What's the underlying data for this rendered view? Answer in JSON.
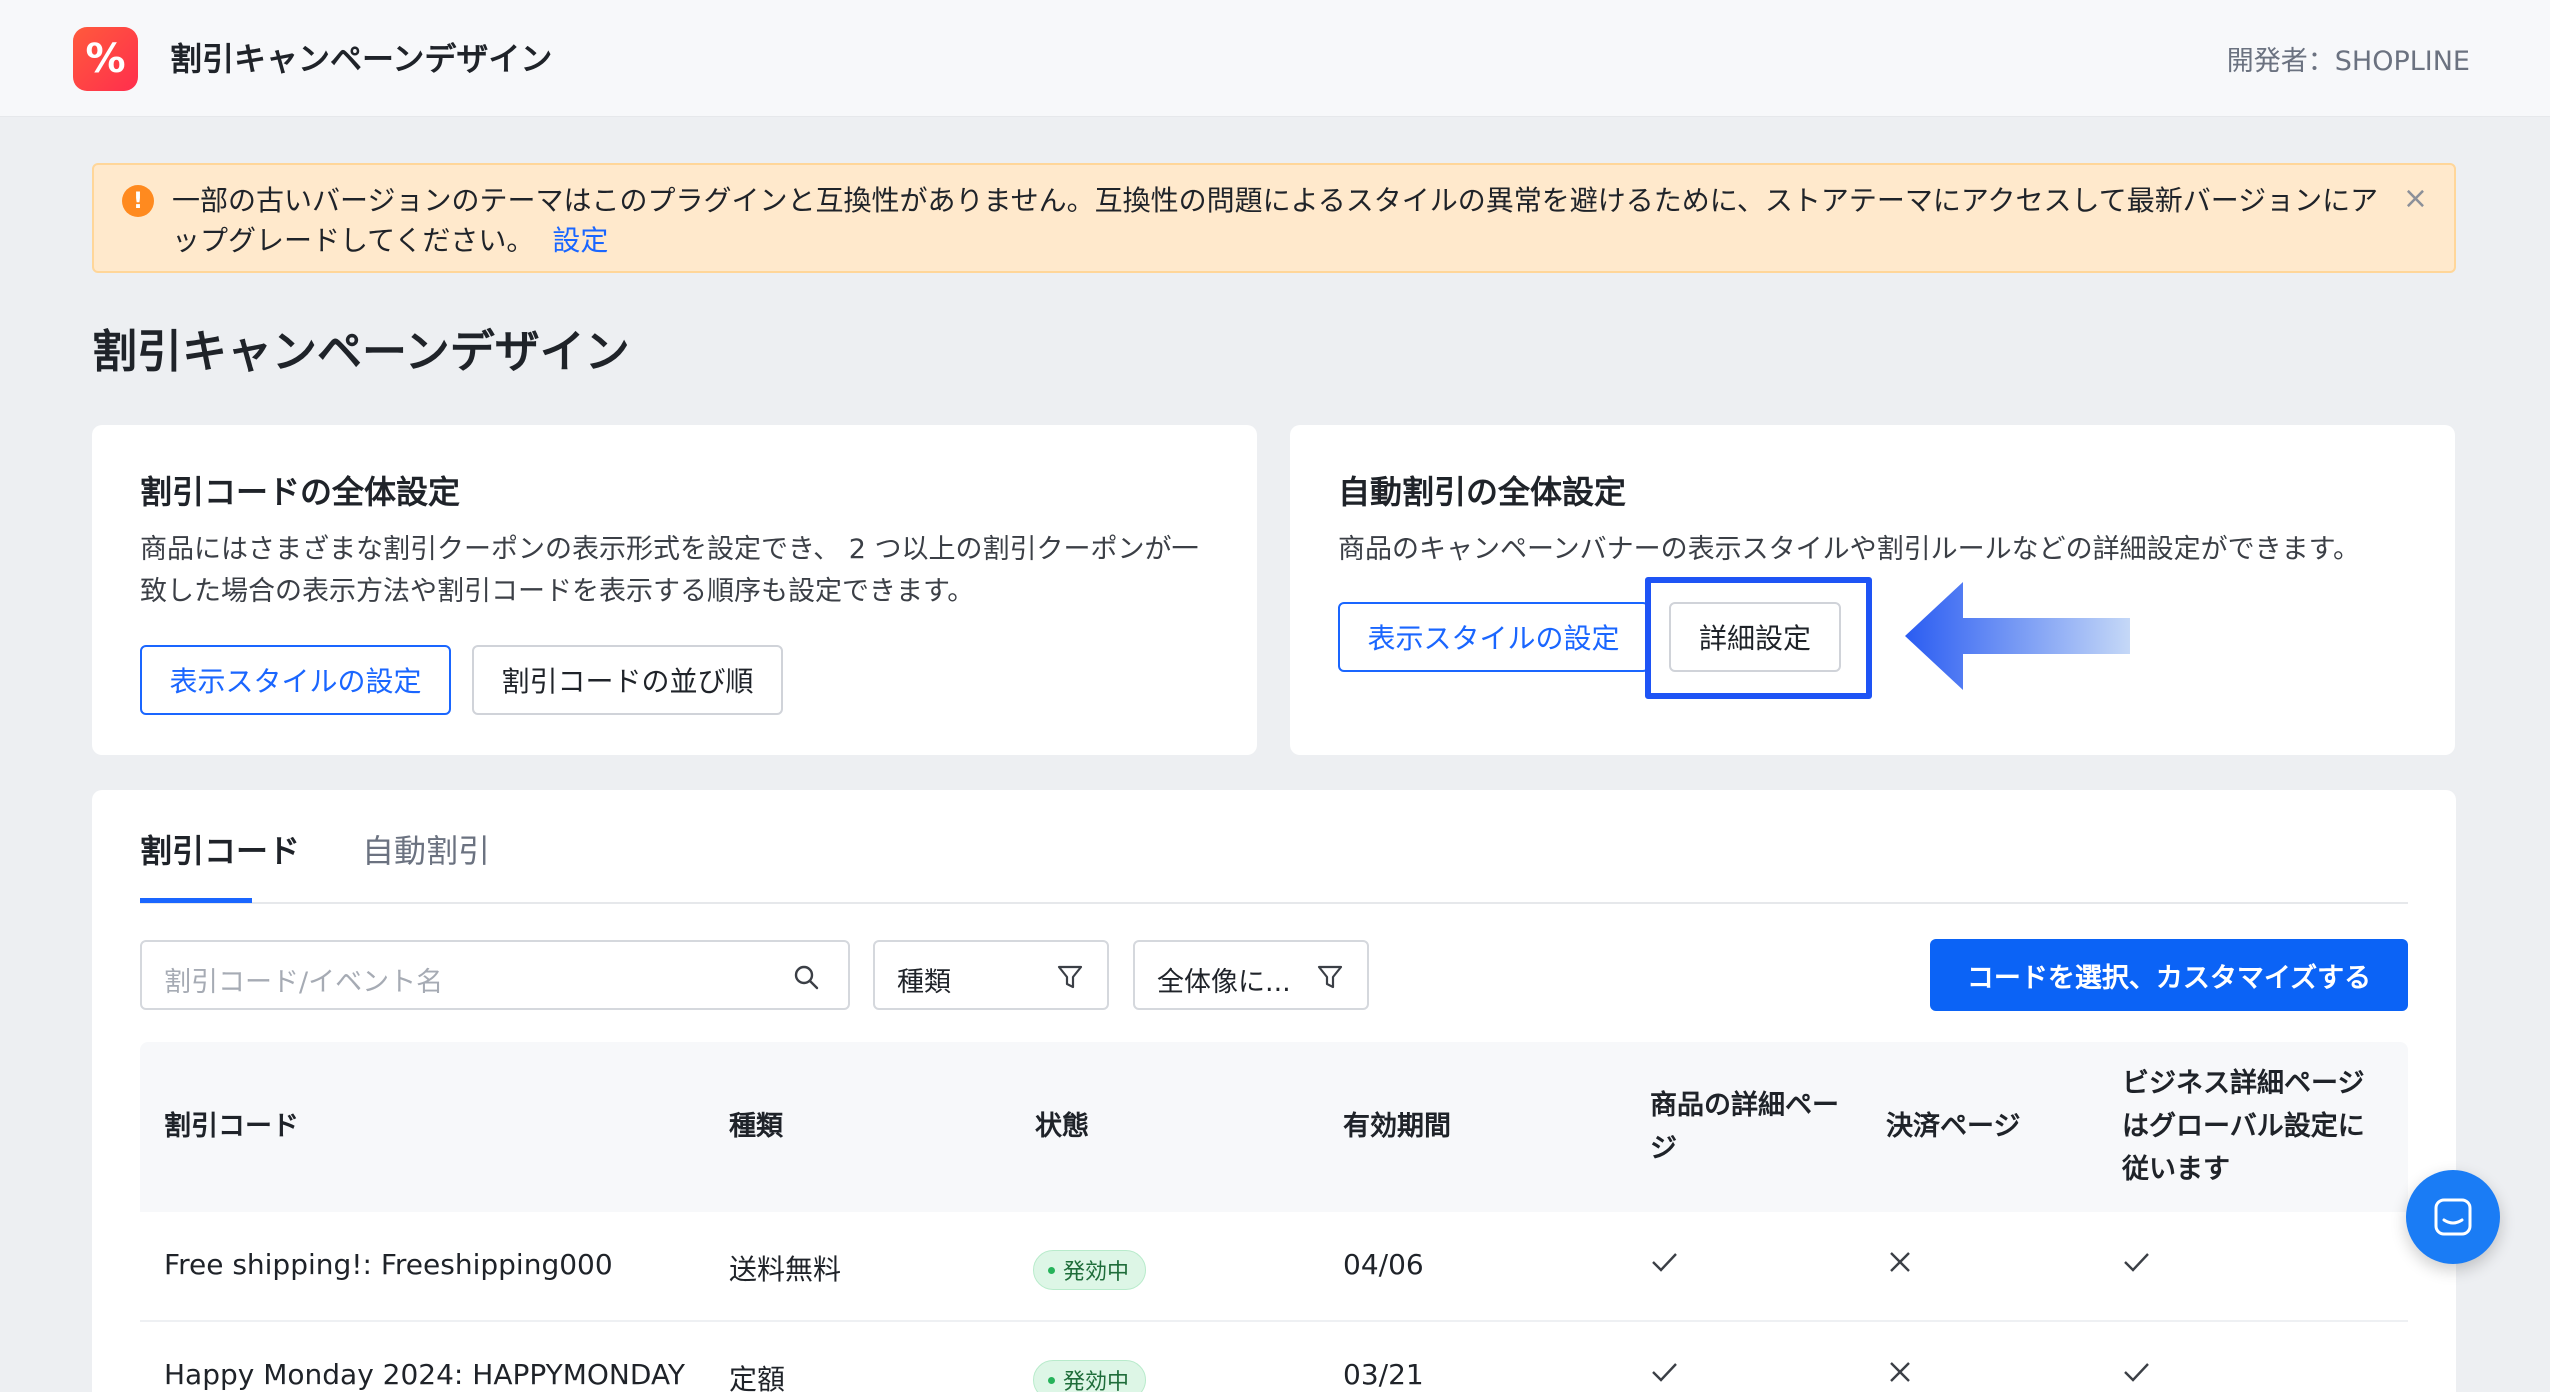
{
  "header": {
    "app_icon_glyph": "%",
    "app_title": "割引キャンペーンデザイン",
    "developer": "開発者：SHOPLINE"
  },
  "alert": {
    "icon": "warning-icon",
    "message": "一部の古いバージョンのテーマはこのプラグインと互換性がありません。互換性の問題によるスタイルの異常を避けるために、ストアテーマにアクセスして最新バージョンにアップグレードしてください。",
    "link_label": "設定",
    "close_glyph": "×"
  },
  "page_title": "割引キャンペーンデザイン",
  "code_settings": {
    "title": "割引コードの全体設定",
    "description": "商品にはさまざまな割引クーポンの表示形式を設定でき、 2 つ以上の割引クーポンが一致した場合の表示方法や割引コードを表示する順序も設定できます。",
    "display_style_button": "表示スタイルの設定",
    "order_button": "割引コードの並び順"
  },
  "auto_settings": {
    "title": "自動割引の全体設定",
    "description": "商品のキャンペーンバナーの表示スタイルや割引ルールなどの詳細設定ができます。",
    "display_style_button": "表示スタイルの設定",
    "advanced_button": "詳細設定"
  },
  "tabs": [
    {
      "label": "割引コード",
      "active": true
    },
    {
      "label": "自動割引",
      "active": false
    }
  ],
  "toolbar": {
    "search_placeholder": "割引コード/イベント名",
    "filter_type": "種類",
    "filter_all": "全体像に...",
    "customize_button": "コードを選択、カスタマイズする"
  },
  "table": {
    "columns": [
      "割引コード",
      "種類",
      "状態",
      "有効期間",
      "商品の詳細ページ",
      "決済ページ",
      "ビジネス詳細ページはグローバル設定に従います"
    ],
    "rows": [
      {
        "code": "Free shipping!: Freeshipping000",
        "type": "送料無料",
        "status": "発効中",
        "period": "04/06",
        "product_page": "check-icon",
        "checkout_page": "cross-icon",
        "global": "check-icon"
      },
      {
        "code": "Happy Monday 2024: HAPPYMONDAY",
        "type": "定額",
        "status": "発効中",
        "period": "03/21",
        "product_page": "check-icon",
        "checkout_page": "cross-icon",
        "global": "check-icon"
      }
    ]
  },
  "colors": {
    "primary": "#1a66ff",
    "alert_bg": "#ffe9cc",
    "status_green": "#26b35a",
    "highlight": "#1e54f5"
  }
}
